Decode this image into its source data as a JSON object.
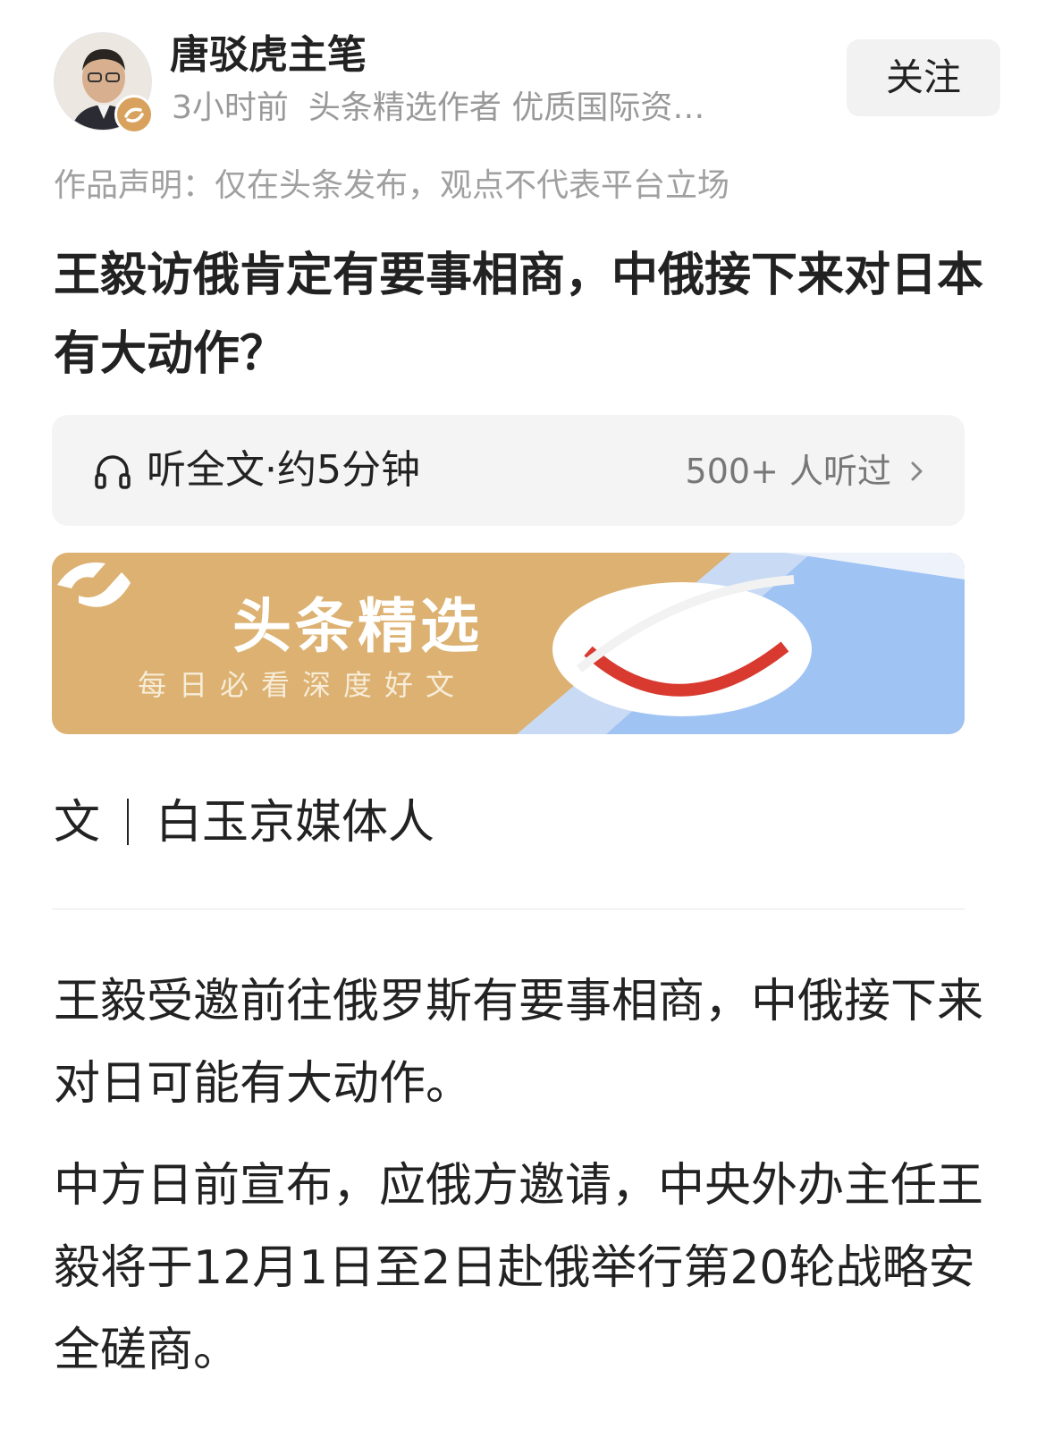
{
  "author": {
    "name": "唐驳虎主笔",
    "time": "3小时前",
    "tags": "头条精选作者 优质国际资…",
    "follow_label": "关注"
  },
  "statement": "作品声明：仅在头条发布，观点不代表平台立场",
  "title": "王毅访俄肯定有要事相商，中俄接下来对日本有大动作？",
  "listen": {
    "label": "听全文·约5分钟",
    "count": "500+ 人听过",
    "icon": "headphones-icon"
  },
  "banner": {
    "title": "头条精选",
    "subtitle": "每日必看深度好文"
  },
  "byline": {
    "prefix": "文",
    "author": "白玉京媒体人"
  },
  "paragraphs": [
    "王毅受邀前往俄罗斯有要事相商，中俄接下来对日可能有大动作。",
    "中方日前宣布，应俄方邀请，中央外办主任王毅将于12月1日至2日赴俄举行第20轮战略安全磋商。"
  ]
}
